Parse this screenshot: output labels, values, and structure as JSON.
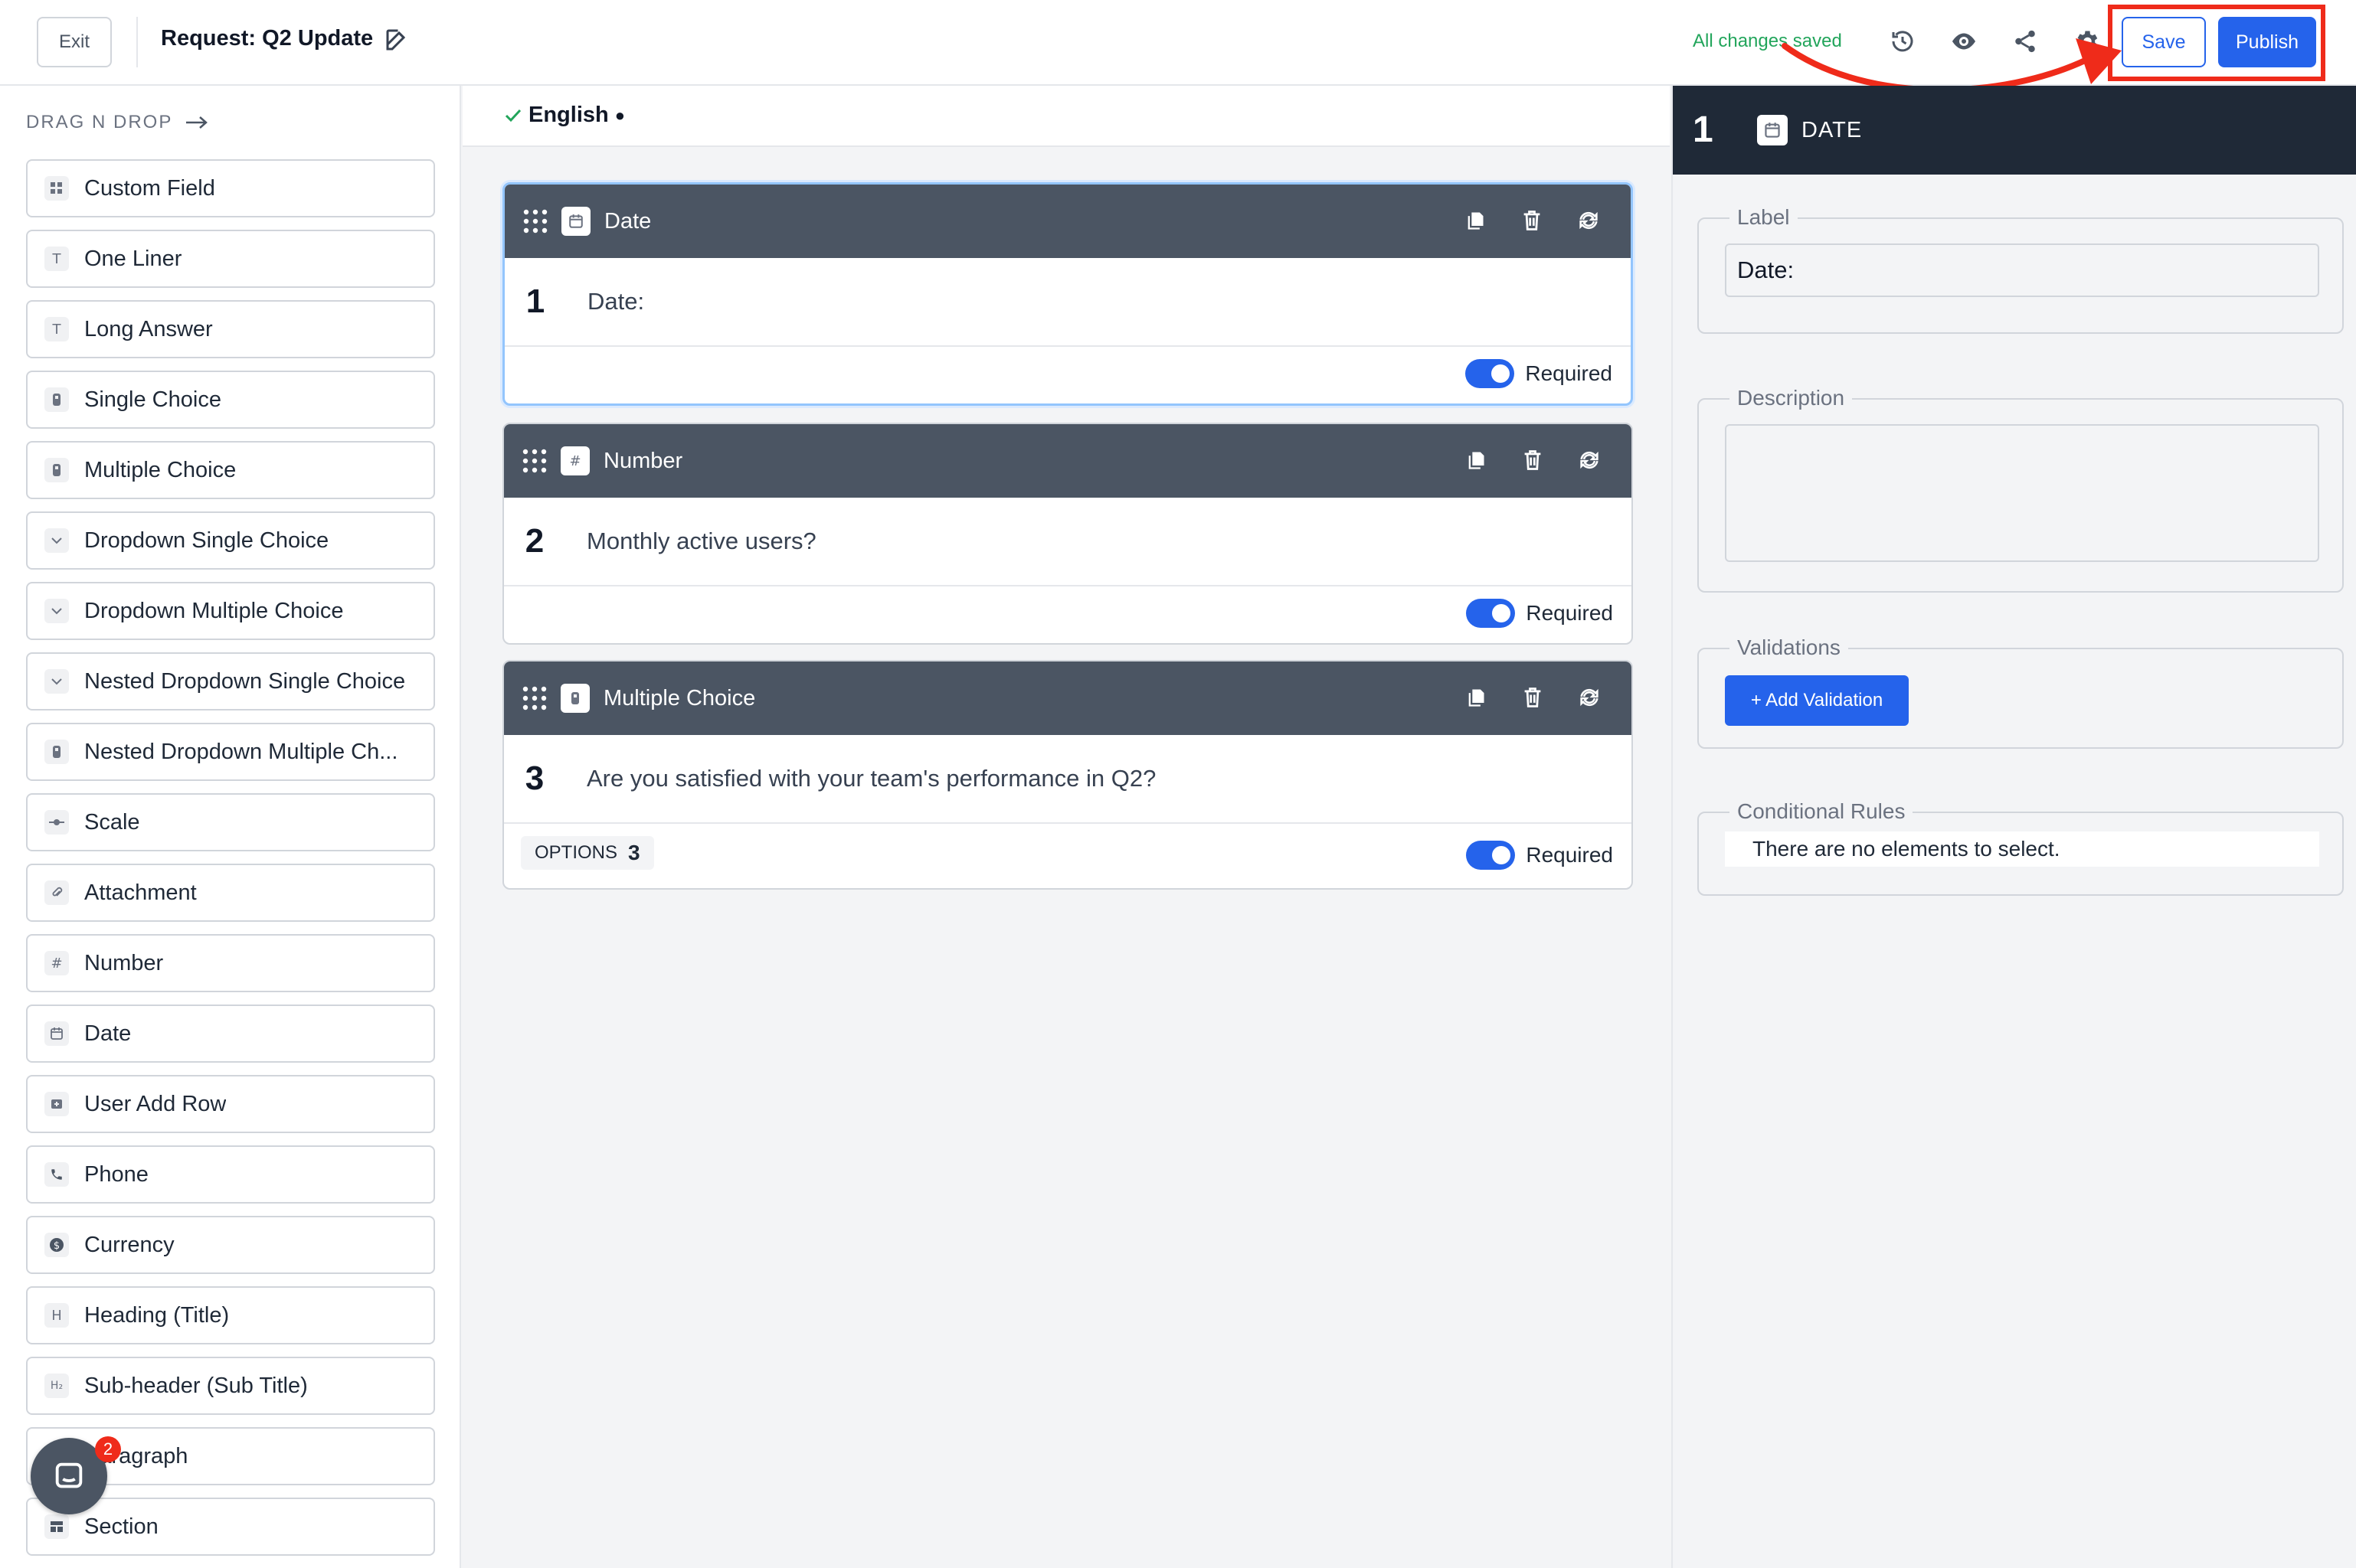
{
  "header": {
    "exit_label": "Exit",
    "title": "Request: Q2 Update",
    "saved_status": "All changes saved",
    "save_label": "Save",
    "publish_label": "Publish"
  },
  "sidebar": {
    "heading": "DRAG N DROP",
    "items": [
      {
        "label": "Custom Field",
        "icon": "grid-icon"
      },
      {
        "label": "One Liner",
        "icon": "text-icon"
      },
      {
        "label": "Long Answer",
        "icon": "text-icon"
      },
      {
        "label": "Single Choice",
        "icon": "choice-icon"
      },
      {
        "label": "Multiple Choice",
        "icon": "choice-icon"
      },
      {
        "label": "Dropdown Single Choice",
        "icon": "chevron-down-icon"
      },
      {
        "label": "Dropdown Multiple Choice",
        "icon": "chevron-down-icon"
      },
      {
        "label": "Nested Dropdown Single Choice",
        "icon": "chevron-down-icon"
      },
      {
        "label": "Nested Dropdown Multiple Ch...",
        "icon": "choice-icon"
      },
      {
        "label": "Scale",
        "icon": "scale-icon"
      },
      {
        "label": "Attachment",
        "icon": "paperclip-icon"
      },
      {
        "label": "Number",
        "icon": "hash-icon"
      },
      {
        "label": "Date",
        "icon": "calendar-icon"
      },
      {
        "label": "User Add Row",
        "icon": "add-row-icon"
      },
      {
        "label": "Phone",
        "icon": "phone-icon"
      },
      {
        "label": "Currency",
        "icon": "currency-icon"
      },
      {
        "label": "Heading (Title)",
        "icon": "heading-icon"
      },
      {
        "label": "Sub-header (Sub Title)",
        "icon": "subheading-icon"
      },
      {
        "label": "Paragraph",
        "icon": "paragraph-icon"
      },
      {
        "label": "Section",
        "icon": "section-icon"
      }
    ],
    "chat_badge": "2"
  },
  "center": {
    "language": "English",
    "cards": [
      {
        "type": "Date",
        "number": "1",
        "question": "Date:",
        "required_label": "Required"
      },
      {
        "type": "Number",
        "number": "2",
        "question": "Monthly active users?",
        "required_label": "Required"
      },
      {
        "type": "Multiple Choice",
        "number": "3",
        "question": "Are you satisfied with your team's performance in Q2?",
        "required_label": "Required",
        "options_label": "OPTIONS",
        "options_count": "3"
      }
    ]
  },
  "panel": {
    "number": "1",
    "title": "DATE",
    "label_legend": "Label",
    "label_value": "Date:",
    "description_legend": "Description",
    "validations_legend": "Validations",
    "add_validation_label": "+ Add Validation",
    "conditional_legend": "Conditional Rules",
    "conditional_empty": "There are no elements to select."
  },
  "colors": {
    "accent": "#2563eb",
    "saved_green": "#22a55b",
    "highlight_red": "#ef2b1a",
    "card_header": "#4b5563",
    "panel_header": "#1f2937"
  }
}
